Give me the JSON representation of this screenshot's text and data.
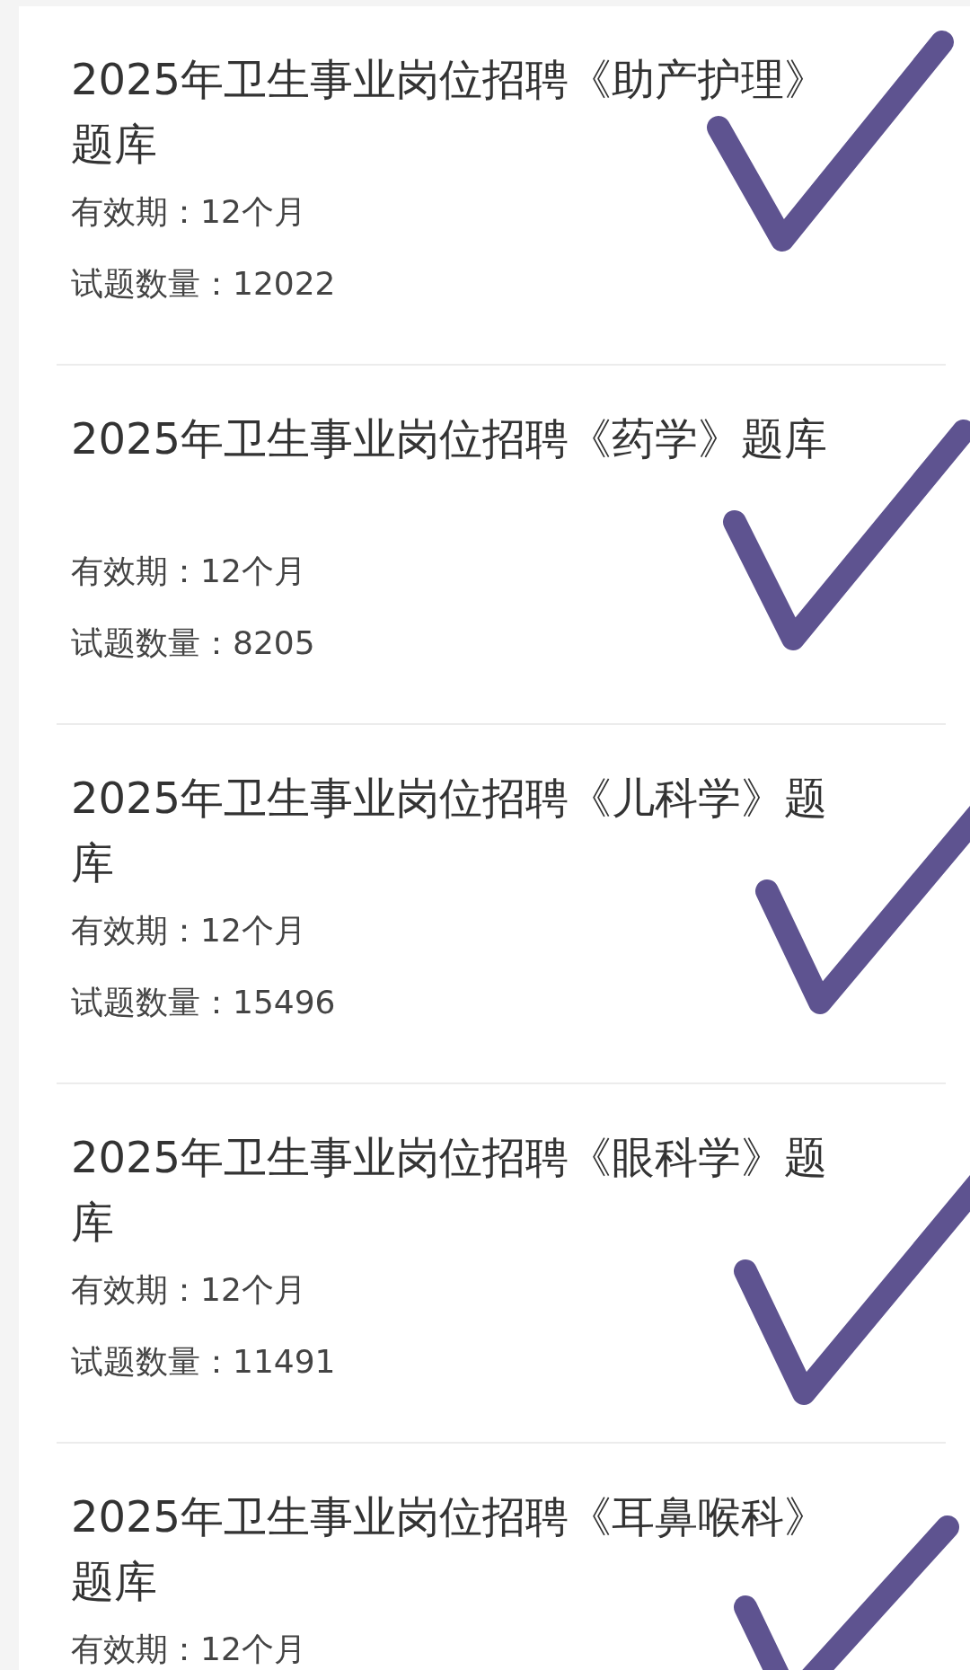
{
  "items": [
    {
      "title": "2025年卫生事业岗位招聘《助产护理》题库",
      "validity": "有效期：12个月",
      "question_count": "试题数量：12022",
      "checked": true
    },
    {
      "title": "2025年卫生事业岗位招聘《药学》题库",
      "validity": "有效期：12个月",
      "question_count": "试题数量：8205",
      "checked": true
    },
    {
      "title": "2025年卫生事业岗位招聘《儿科学》题库",
      "validity": "有效期：12个月",
      "question_count": "试题数量：15496",
      "checked": true
    },
    {
      "title": "2025年卫生事业岗位招聘《眼科学》题库",
      "validity": "有效期：12个月",
      "question_count": "试题数量：11491",
      "checked": true
    },
    {
      "title": "2025年卫生事业岗位招聘《耳鼻喉科》题库",
      "validity": "有效期：12个月",
      "checked": true
    }
  ]
}
